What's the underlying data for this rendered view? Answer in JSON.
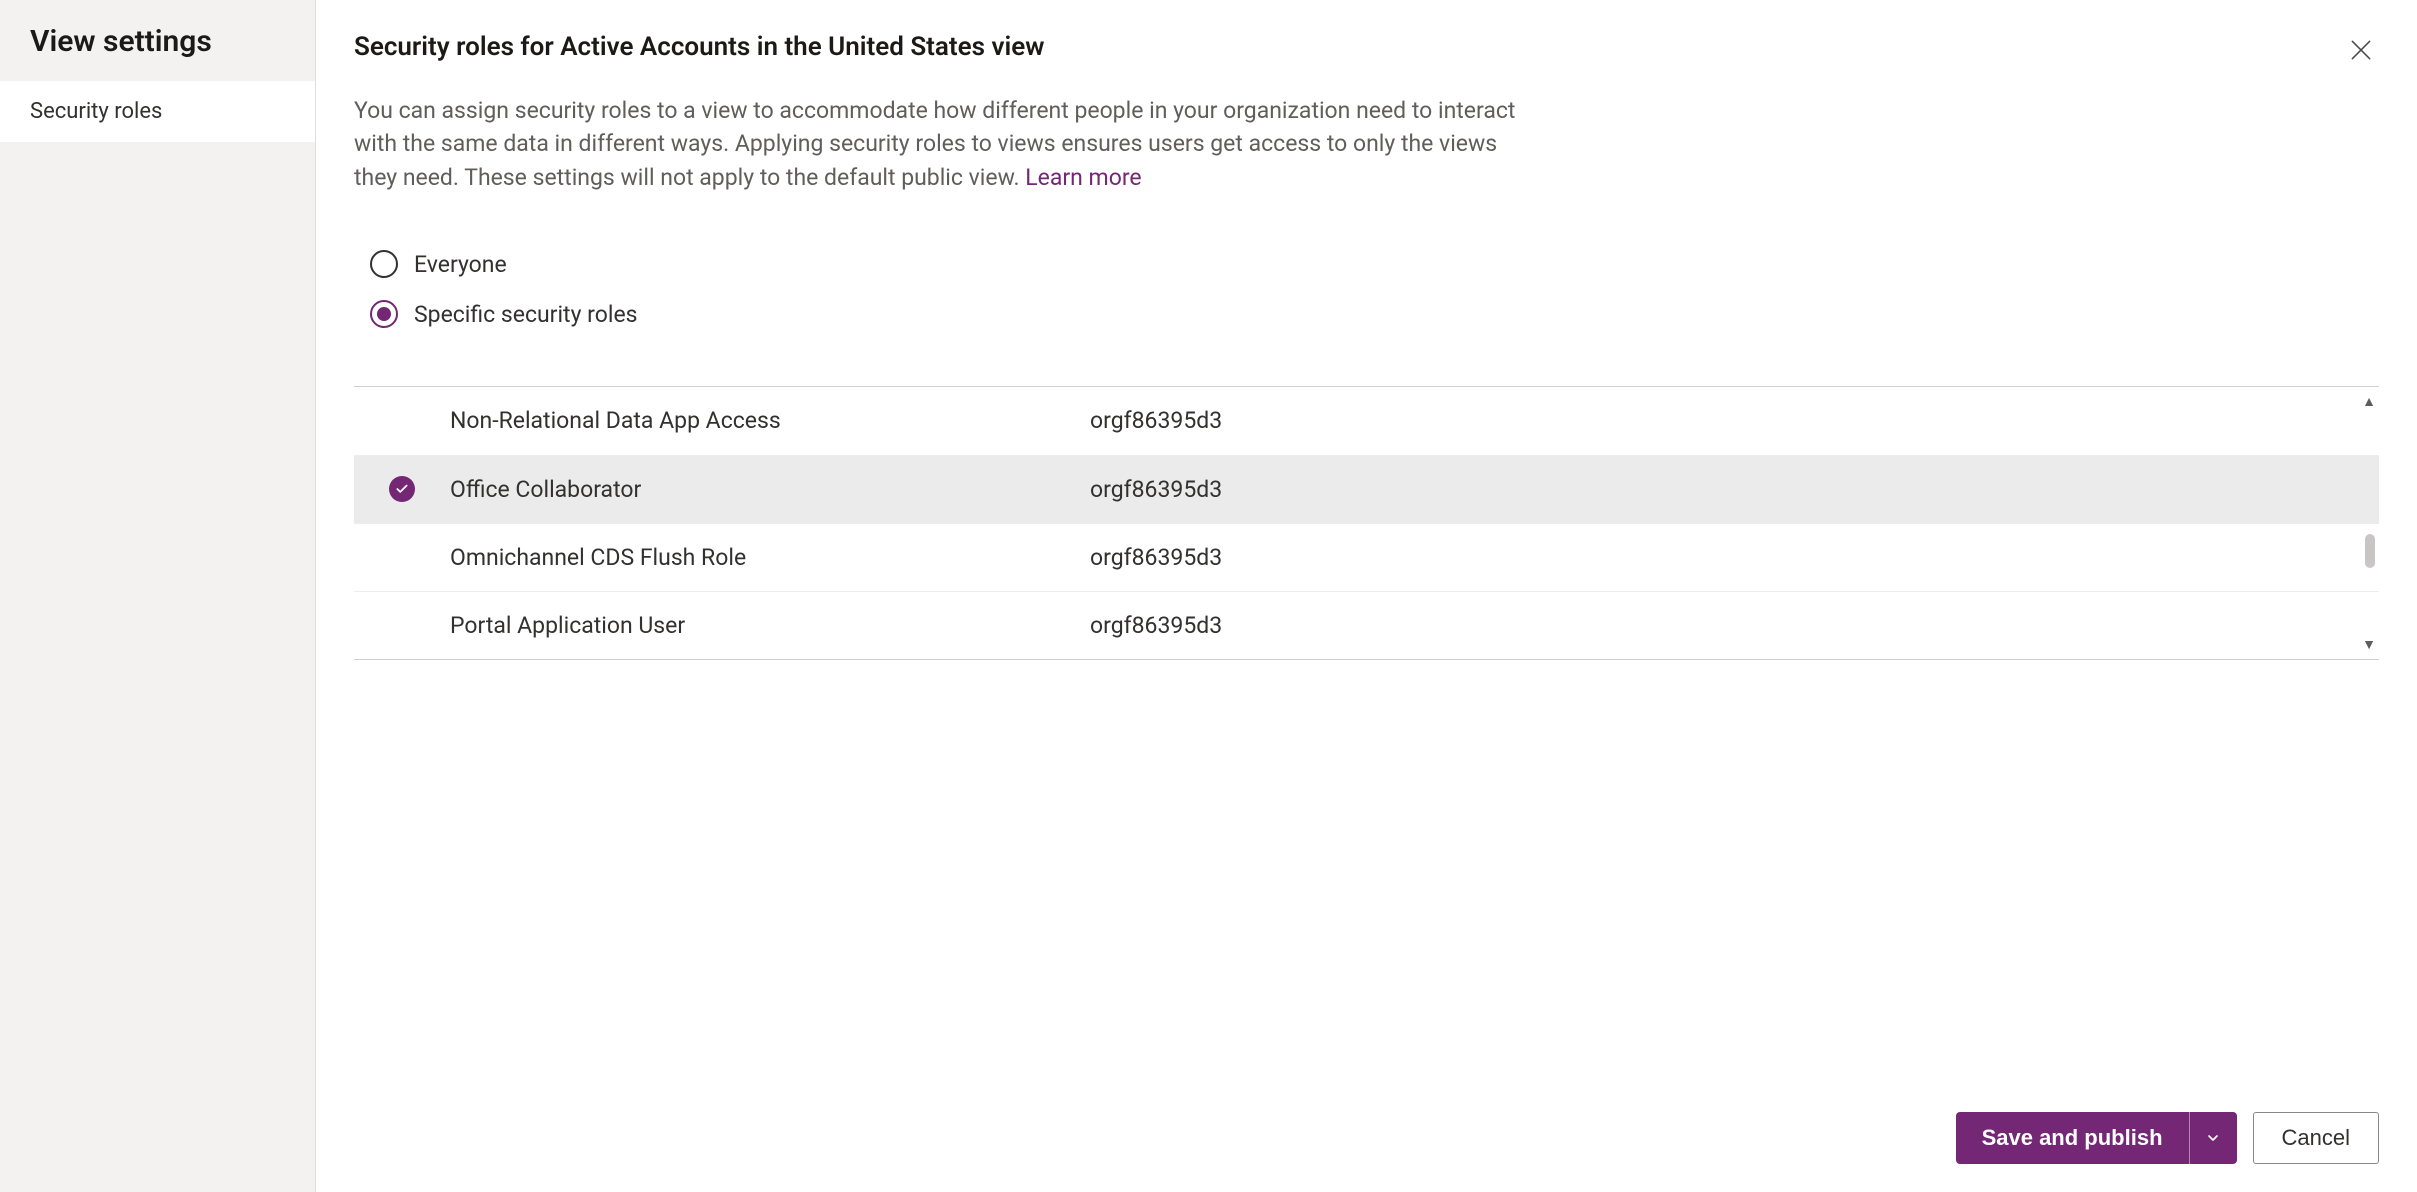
{
  "sidebar": {
    "title": "View settings",
    "items": [
      {
        "label": "Security roles",
        "active": true
      }
    ]
  },
  "header": {
    "title": "Security roles for Active Accounts in the United States view"
  },
  "description": {
    "text": "You can assign security roles to a view to accommodate how different people in your organization need to interact with the same data in different ways. Applying security roles to views ensures users get access to only the views they need. These settings will not apply to the default public view. ",
    "learn_more_label": "Learn more"
  },
  "radio": {
    "everyone_label": "Everyone",
    "specific_label": "Specific security roles",
    "selected": "specific"
  },
  "roles": [
    {
      "name": "Non-Relational Data App Access",
      "org": "orgf86395d3",
      "selected": false
    },
    {
      "name": "Office Collaborator",
      "org": "orgf86395d3",
      "selected": true
    },
    {
      "name": "Omnichannel CDS Flush Role",
      "org": "orgf86395d3",
      "selected": false
    },
    {
      "name": "Portal Application User",
      "org": "orgf86395d3",
      "selected": false
    }
  ],
  "footer": {
    "save_label": "Save and publish",
    "cancel_label": "Cancel"
  }
}
